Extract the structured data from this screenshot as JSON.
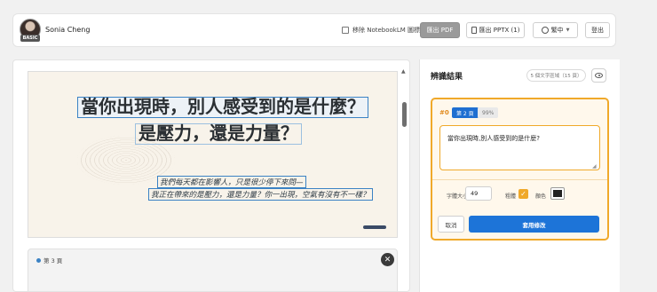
{
  "header": {
    "avatar_badge": "BASIC",
    "username": "Sonia Cheng",
    "remove_watermark_label": "移除 NotebookLM 圖標",
    "remove_watermark_checked": false,
    "export_pdf_label": "匯出 PDF",
    "export_pptx_label": "匯出 PPTX (1)",
    "language_label": "繁中",
    "logout_label": "登出"
  },
  "preview": {
    "slide": {
      "title_line1": "當你出現時，別人感受到的是什麼？",
      "title_line2": "是壓力，還是力量？",
      "body_line1": "我們每天都在影響人，只是很少停下來問—",
      "body_line2": "我正在帶來的是壓力，還是力量？你一出現，空氣有沒有不一樣？"
    },
    "next_page_label": "第 3 頁",
    "close_symbol": "✕"
  },
  "results": {
    "title": "辨識結果",
    "count_badge": "5 個文字區域（15 頁）",
    "card": {
      "index": "#0",
      "page_badge": "第 2 頁",
      "confidence": "99%",
      "text_value": "當你出現時,別人感受到的是什麼?",
      "font_size_label": "字體大小",
      "font_size_value": "49",
      "bold_label": "粗體",
      "bold_checked": true,
      "color_label": "顏色",
      "color_value": "#222222",
      "cancel_label": "取消",
      "apply_label": "套用修改"
    }
  },
  "icons": {
    "avatar": "avatar",
    "pptx": "document-icon",
    "pdf": "document-icon",
    "language": "globe-icon",
    "visibility": "eye-icon",
    "close": "close-icon"
  },
  "colors": {
    "accent_blue": "#1d74d8",
    "accent_orange": "#f0a92a",
    "card_bg": "#fff8ec"
  }
}
